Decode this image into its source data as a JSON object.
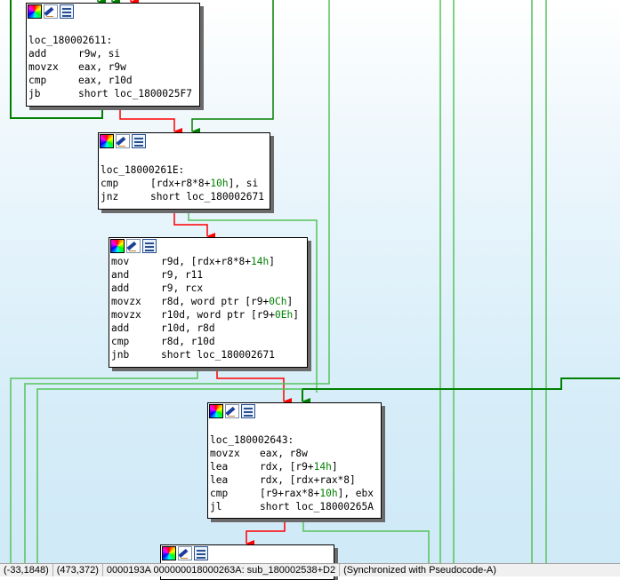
{
  "palette": {
    "edge_true": "#008000",
    "edge_false": "#ff0000",
    "immediate": "#008000"
  },
  "node_header_icons": [
    "color-palette-icon",
    "rename-icon",
    "group-icon"
  ],
  "blocks": [
    {
      "id": "block-180002611",
      "label": "loc_180002611:",
      "lines": [
        {
          "mn": "add",
          "ops": [
            {
              "t": "r9w, si"
            }
          ]
        },
        {
          "mn": "movzx",
          "ops": [
            {
              "t": "eax, r9w"
            }
          ]
        },
        {
          "mn": "cmp",
          "ops": [
            {
              "t": "eax, r10d"
            }
          ]
        },
        {
          "mn": "jb",
          "ops": [
            {
              "t": "short loc_1800025F7"
            }
          ]
        }
      ]
    },
    {
      "id": "block-18000261E",
      "label": "loc_18000261E:",
      "lines": [
        {
          "mn": "cmp",
          "ops": [
            {
              "t": "[rdx+r8*8+"
            },
            {
              "t": "10h",
              "num": true
            },
            {
              "t": "], si"
            }
          ]
        },
        {
          "mn": "jnz",
          "ops": [
            {
              "t": "short loc_180002671"
            }
          ]
        }
      ]
    },
    {
      "id": "block-mov-r9d",
      "label": "",
      "lines": [
        {
          "mn": "mov",
          "ops": [
            {
              "t": "r9d, [rdx+r8*8+"
            },
            {
              "t": "14h",
              "num": true
            },
            {
              "t": "]"
            }
          ]
        },
        {
          "mn": "and",
          "ops": [
            {
              "t": "r9, r11"
            }
          ]
        },
        {
          "mn": "add",
          "ops": [
            {
              "t": "r9, rcx"
            }
          ]
        },
        {
          "mn": "movzx",
          "ops": [
            {
              "t": "r8d, word ptr [r9+"
            },
            {
              "t": "0Ch",
              "num": true
            },
            {
              "t": "]"
            }
          ]
        },
        {
          "mn": "movzx",
          "ops": [
            {
              "t": "r10d, word ptr [r9+"
            },
            {
              "t": "0Eh",
              "num": true
            },
            {
              "t": "]"
            }
          ]
        },
        {
          "mn": "add",
          "ops": [
            {
              "t": "r10d, r8d"
            }
          ]
        },
        {
          "mn": "cmp",
          "ops": [
            {
              "t": "r8d, r10d"
            }
          ]
        },
        {
          "mn": "jnb",
          "ops": [
            {
              "t": "short loc_180002671"
            }
          ]
        }
      ]
    },
    {
      "id": "block-180002643",
      "label": "loc_180002643:",
      "lines": [
        {
          "mn": "movzx",
          "ops": [
            {
              "t": "eax, r8w"
            }
          ]
        },
        {
          "mn": "lea",
          "ops": [
            {
              "t": "rdx, [r9+"
            },
            {
              "t": "14h",
              "num": true
            },
            {
              "t": "]"
            }
          ]
        },
        {
          "mn": "lea",
          "ops": [
            {
              "t": "rdx, [rdx+rax*8]"
            }
          ]
        },
        {
          "mn": "cmp",
          "ops": [
            {
              "t": "[r9+rax*8+"
            },
            {
              "t": "10h",
              "num": true
            },
            {
              "t": "], ebx"
            }
          ]
        },
        {
          "mn": "jl",
          "ops": [
            {
              "t": "short loc_18000265A"
            }
          ]
        }
      ]
    },
    {
      "id": "block-bottom-partial",
      "label": "",
      "lines": []
    }
  ],
  "status_bar": {
    "coords": "(-33,1848)",
    "size": "(473,372)",
    "address": "0000193A 000000018000263A: sub_180002538+D2",
    "sync": "(Synchronized with Pseudocode-A)"
  }
}
